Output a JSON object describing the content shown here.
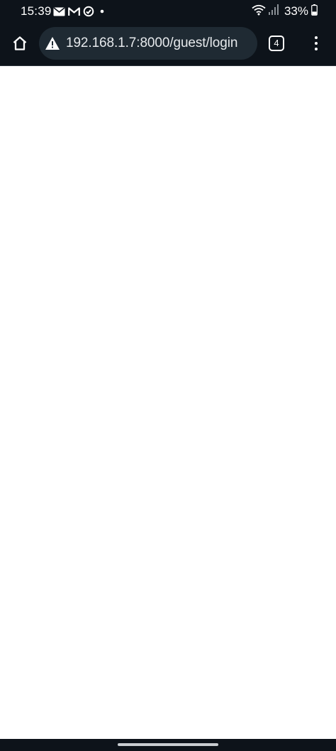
{
  "status_bar": {
    "time": "15:39",
    "left_icons": [
      "email-icon",
      "gmail-icon",
      "sync-icon",
      "dot-icon"
    ],
    "right_icons": [
      "wifi-icon",
      "signal-icon",
      "battery-icon"
    ],
    "battery_text": "33%",
    "battery_level": 0.33
  },
  "toolbar": {
    "home_icon": "home-icon",
    "security_icon": "warning-icon",
    "url": "192.168.1.7:8000/guest/login",
    "tab_count": "4",
    "menu_icon": "more-vert-icon"
  },
  "colors": {
    "bar_background": "#0d131a",
    "url_bar_background": "#1f2a33",
    "page_background": "#ffffff"
  }
}
